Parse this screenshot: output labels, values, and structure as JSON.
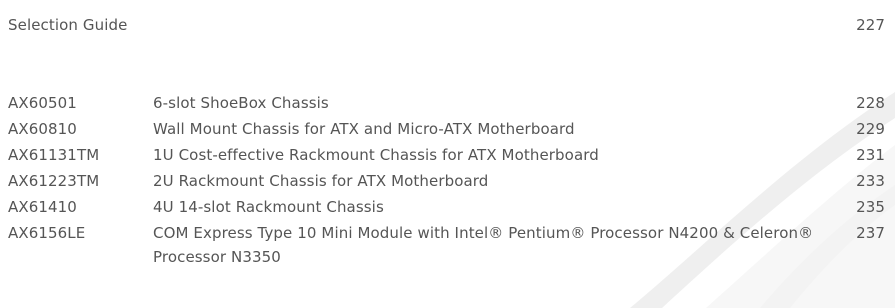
{
  "heading": {
    "title": "Selection Guide",
    "page": "227"
  },
  "entries": [
    {
      "code": "AX60501",
      "description": "6-slot ShoeBox Chassis",
      "page": "228"
    },
    {
      "code": "AX60810",
      "description": "Wall Mount Chassis for ATX and Micro-ATX Motherboard",
      "page": "229"
    },
    {
      "code": "AX61131TM",
      "description": "1U Cost-effective Rackmount Chassis for ATX Motherboard",
      "page": "231"
    },
    {
      "code": "AX61223TM",
      "description": "2U Rackmount Chassis for ATX Motherboard",
      "page": "233"
    },
    {
      "code": "AX61410",
      "description": "4U 14-slot Rackmount Chassis",
      "page": "235"
    },
    {
      "code": "AX6156LE",
      "description": "COM Express Type 10 Mini Module with Intel® Pentium® Processor N4200 & Celeron® Processor N3350",
      "page": "237"
    }
  ]
}
